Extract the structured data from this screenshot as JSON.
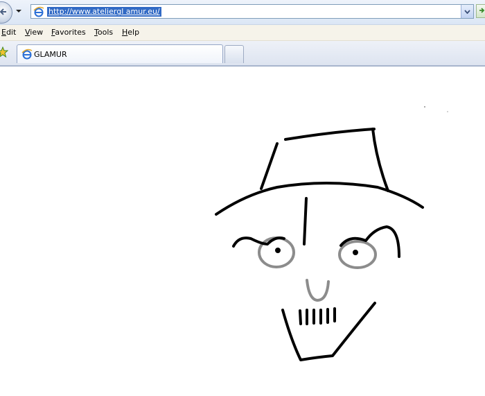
{
  "address_bar": {
    "url": "http://www.ateliergl amur.eu/"
  },
  "menu": {
    "items": [
      {
        "access_key": "E",
        "rest": "dit"
      },
      {
        "access_key": "V",
        "rest": "iew"
      },
      {
        "access_key": "F",
        "rest": "avorites"
      },
      {
        "access_key": "T",
        "rest": "ools"
      },
      {
        "access_key": "H",
        "rest": "elp"
      }
    ]
  },
  "tabs": [
    {
      "label": "GLAMUR",
      "icon": "ie-icon",
      "active": true
    }
  ],
  "icons": {
    "back": "back-arrow-icon",
    "favorites": "favorites-star-icon",
    "page": "ie-icon",
    "new_tab": "new-tab-icon"
  },
  "colors": {
    "url_highlight": "#316ac5",
    "sketch_black": "#000000",
    "sketch_gray": "#8c8c8c"
  }
}
